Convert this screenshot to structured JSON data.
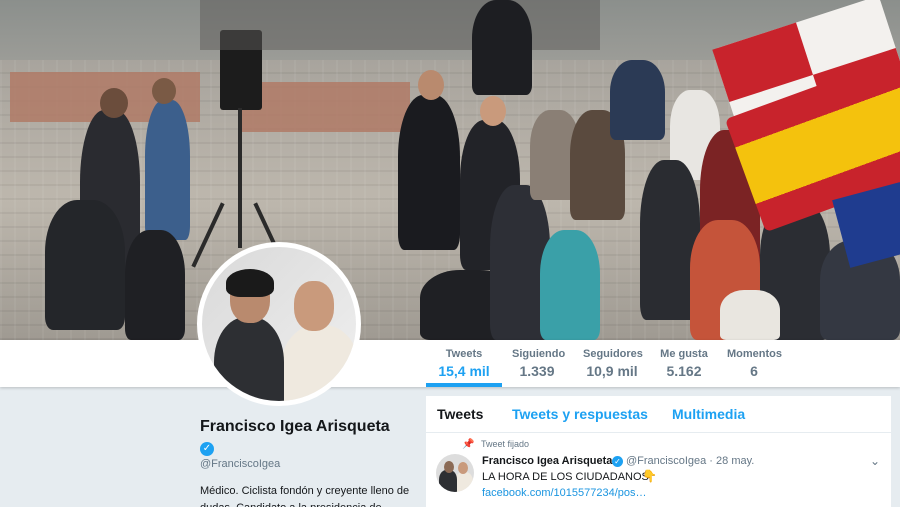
{
  "profile": {
    "name": "Francisco Igea Arisqueta",
    "handle": "@FranciscoIgea",
    "bio": "Médico. Ciclista fondón y creyente lleno de dudas. Candidato a la presidencia de"
  },
  "stats": [
    {
      "label": "Tweets",
      "value": "15,4 mil"
    },
    {
      "label": "Siguiendo",
      "value": "1.339"
    },
    {
      "label": "Seguidores",
      "value": "10,9 mil"
    },
    {
      "label": "Me gusta",
      "value": "5.162"
    },
    {
      "label": "Momentos",
      "value": "6"
    }
  ],
  "tabs": [
    {
      "label": "Tweets"
    },
    {
      "label": "Tweets y respuestas"
    },
    {
      "label": "Multimedia"
    }
  ],
  "pinned_tweet": {
    "pinned_label": "Tweet fijado",
    "author": "Francisco Igea Arisqueta",
    "meta": "@FranciscoIgea · 28 may.",
    "text": "LA HORA DE LOS CIUDADANOS",
    "link": "facebook.com/1015577234/pos…"
  },
  "colors": {
    "accent": "#1da1f2",
    "text": "#14171a",
    "muted": "#657786",
    "background": "#e6ecf0"
  }
}
